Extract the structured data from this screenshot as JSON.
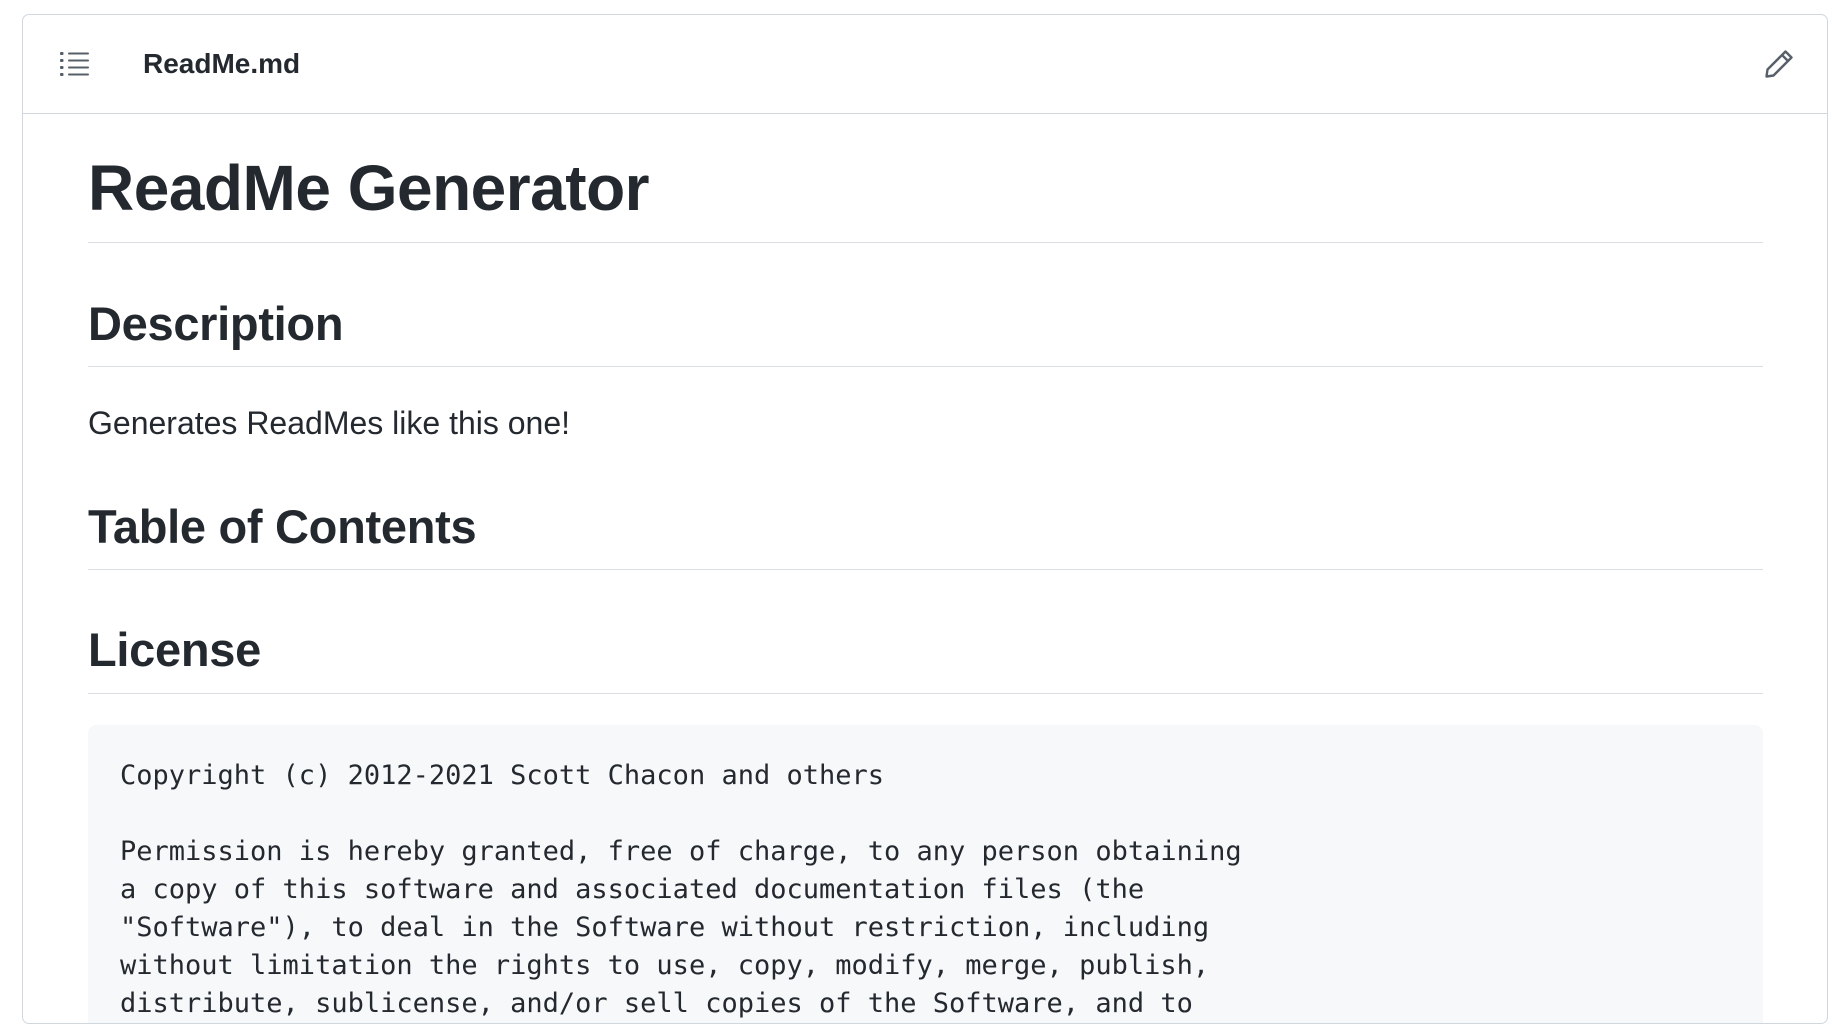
{
  "file": {
    "name": "ReadMe.md"
  },
  "icons": {
    "toc": "list-unordered-icon",
    "edit": "pencil-icon"
  },
  "readme": {
    "title": "ReadMe Generator",
    "description_heading": "Description",
    "description_text": "Generates ReadMes like this one!",
    "toc_heading": "Table of Contents",
    "license_heading": "License",
    "license_lines": [
      "Copyright (c) 2012-2021 Scott Chacon and others",
      "",
      "Permission is hereby granted, free of charge, to any person obtaining",
      "a copy of this software and associated documentation files (the",
      "\"Software\"), to deal in the Software without restriction, including",
      "without limitation the rights to use, copy, modify, merge, publish,",
      "distribute, sublicense, and/or sell copies of the Software, and to"
    ]
  },
  "colors": {
    "border": "#d0d7de",
    "text": "#24292f",
    "icon": "#57606a",
    "code_bg": "#f6f8fa"
  }
}
